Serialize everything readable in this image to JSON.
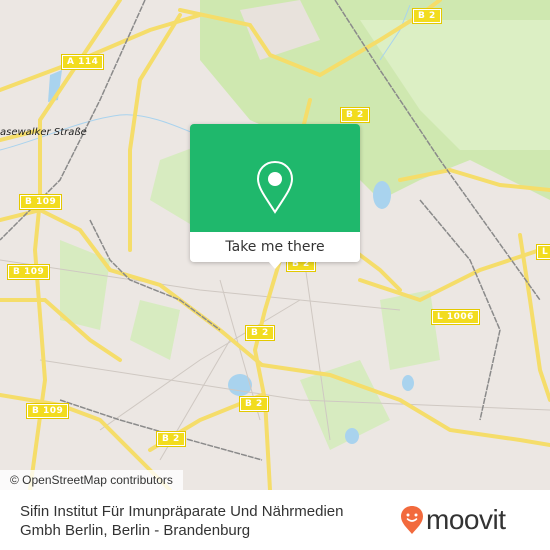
{
  "map": {
    "place_labels": [
      {
        "id": "prenzlauer",
        "text": "asewalker Straße"
      }
    ],
    "road_shields": [
      {
        "id": "a114",
        "text": "A 114"
      },
      {
        "id": "b2-top",
        "text": "B 2"
      },
      {
        "id": "b2-upper",
        "text": "B 2"
      },
      {
        "id": "b109-upper",
        "text": "B 109"
      },
      {
        "id": "b109-mid",
        "text": "B 109"
      },
      {
        "id": "b2-center",
        "text": "B 2"
      },
      {
        "id": "b2-popup",
        "text": "B 2"
      },
      {
        "id": "l1006",
        "text": "L 1006"
      },
      {
        "id": "b109-lower",
        "text": "B 109"
      },
      {
        "id": "b2-lower",
        "text": "B 2"
      },
      {
        "id": "b2-bottom",
        "text": "B 2"
      },
      {
        "id": "l-right",
        "text": "L"
      }
    ],
    "attribution": "© OpenStreetMap contributors",
    "colors": {
      "land": "#ece7e3",
      "park": "#cfe8b0",
      "water": "#a9d3ee",
      "road_major": "#f5dd6a",
      "railway": "#888888"
    }
  },
  "popup": {
    "action_label": "Take me there",
    "icon": "map-pin-icon",
    "accent_color": "#1fb86c"
  },
  "footer": {
    "place_name": "Sifin Institut Für Imunpräparate Und Nährmedien Gmbh Berlin, Berlin - Brandenburg",
    "brand": {
      "name": "moovit",
      "icon": "moovit-pin-icon",
      "color": "#f26a3d"
    }
  }
}
